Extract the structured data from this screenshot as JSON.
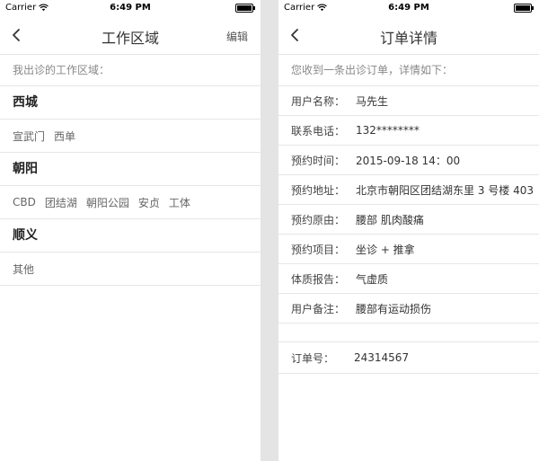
{
  "status_bar": {
    "carrier": "Carrier",
    "time": "6:49 PM",
    "battery_fraction": 1.0
  },
  "left_screen": {
    "title": "工作区域",
    "edit_label": "编辑",
    "intro": "我出诊的工作区域：",
    "regions": [
      {
        "name": "西城",
        "areas": [
          "宣武门",
          "西单"
        ]
      },
      {
        "name": "朝阳",
        "areas": [
          "CBD",
          "团结湖",
          "朝阳公园",
          "安贞",
          "工体"
        ]
      },
      {
        "name": "顺义",
        "areas": [
          "其他"
        ]
      }
    ]
  },
  "right_screen": {
    "title": "订单详情",
    "intro": "您收到一条出诊订单，详情如下：",
    "details": [
      {
        "label": "用户名称：",
        "value": "马先生"
      },
      {
        "label": "联系电话：",
        "value": "132********"
      },
      {
        "label": "预约时间：",
        "value": "2015-09-18  14：00"
      },
      {
        "label": "预约地址：",
        "value": "北京市朝阳区团结湖东里 3 号楼 403"
      },
      {
        "label": "预约原由：",
        "value": "腰部  肌肉酸痛"
      },
      {
        "label": "预约项目：",
        "value": "坐诊 + 推拿"
      },
      {
        "label": "体质报告：",
        "value": "气虚质"
      },
      {
        "label": "用户备注：",
        "value": "腰部有运动损伤"
      }
    ],
    "order": {
      "label": "订单号：",
      "value": "24314567"
    }
  },
  "icons": {
    "back": "chevron-left-icon",
    "wifi": "wifi-icon",
    "battery": "battery-icon"
  }
}
